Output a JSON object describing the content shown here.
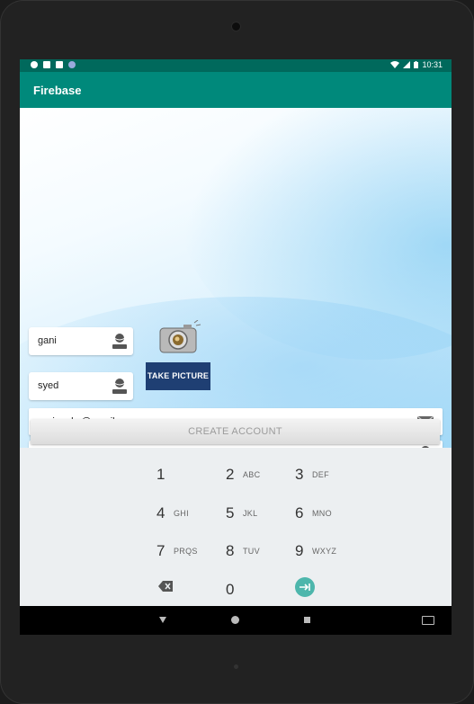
{
  "status_bar": {
    "time": "10:31"
  },
  "app_bar": {
    "title": "Firebase"
  },
  "form": {
    "first_name_value": "gani",
    "last_name_value": "syed",
    "take_picture_label": "TAKE PICTURE",
    "email_value": "gani.umkc@gmail.com",
    "password_value": "••••••",
    "create_account_label": "CREATE ACCOUNT"
  },
  "keypad": {
    "keys": [
      {
        "num": "1",
        "letters": ""
      },
      {
        "num": "2",
        "letters": "ABC"
      },
      {
        "num": "3",
        "letters": "DEF"
      },
      {
        "num": "4",
        "letters": "GHI"
      },
      {
        "num": "5",
        "letters": "JKL"
      },
      {
        "num": "6",
        "letters": "MNO"
      },
      {
        "num": "7",
        "letters": "PRQS"
      },
      {
        "num": "8",
        "letters": "TUV"
      },
      {
        "num": "9",
        "letters": "WXYZ"
      },
      {
        "num": "0",
        "letters": ""
      }
    ]
  },
  "icons": {
    "status_left": [
      "gear-icon",
      "image-icon",
      "sd-card-icon",
      "circle-icon"
    ],
    "status_right": [
      "wifi-icon",
      "signal-icon",
      "battery-icon"
    ],
    "person": "person-icon",
    "camera": "camera-icon",
    "mail": "mail-icon",
    "lock": "lock-icon",
    "backspace": "backspace-icon",
    "next": "next-field-icon"
  },
  "colors": {
    "app_bar": "#00897b",
    "status_bar": "#00695c",
    "take_picture_bg": "#1f3f73",
    "next_key": "#4db6ac"
  }
}
